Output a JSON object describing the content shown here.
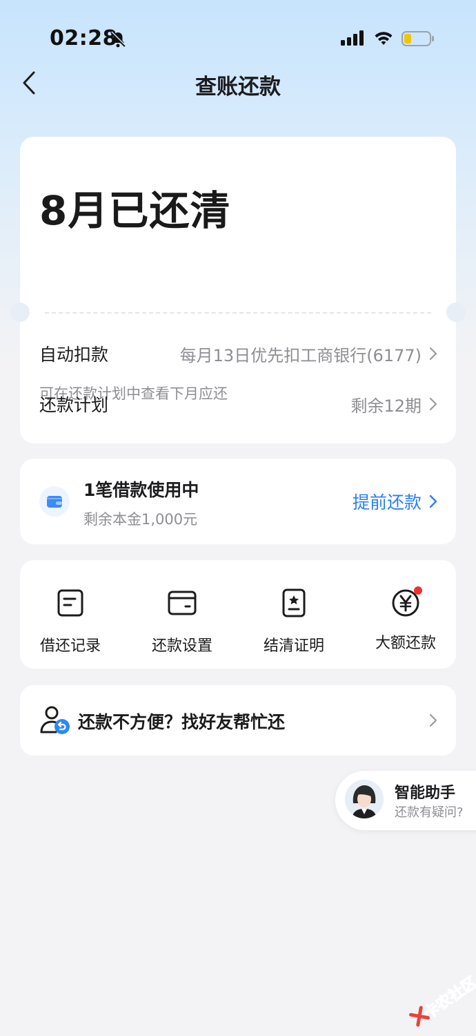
{
  "status_bar": {
    "time": "02:28",
    "icons": [
      "bell-off-icon",
      "signal-icon",
      "wifi-icon",
      "battery-icon"
    ]
  },
  "nav": {
    "back_icon": "chevron-left-icon",
    "title": "查账还款"
  },
  "status_card": {
    "title": "8月已还清",
    "subtitle": "可在还款计划中查看下月应还",
    "rows": [
      {
        "label": "自动扣款",
        "value": "每月13日优先扣工商银行(6177)"
      },
      {
        "label": "还款计划",
        "value": "剩余12期"
      }
    ]
  },
  "loan_card": {
    "icon": "wallet-icon",
    "title": "1笔借款使用中",
    "subtitle": "剩余本金1,000元",
    "action_label": "提前还款"
  },
  "actions": [
    {
      "icon": "record-icon",
      "label": "借还记录"
    },
    {
      "icon": "card-settings-icon",
      "label": "还款设置"
    },
    {
      "icon": "certificate-icon",
      "label": "结清证明"
    },
    {
      "icon": "yuan-icon",
      "label": "大额还款",
      "has_badge": true
    }
  ],
  "friend_card": {
    "icon": "friend-help-icon",
    "text": "还款不方便？找好友帮忙还"
  },
  "assistant": {
    "title": "智能助手",
    "subtitle": "还款有疑问?"
  },
  "watermark": {
    "text": "卡农社区"
  },
  "colors": {
    "accent": "#2a7ff5",
    "badge": "#f0302d",
    "muted_text": "#8e8e93",
    "background": "#f3f3f5",
    "top_gradient": "#c7e4fd"
  }
}
